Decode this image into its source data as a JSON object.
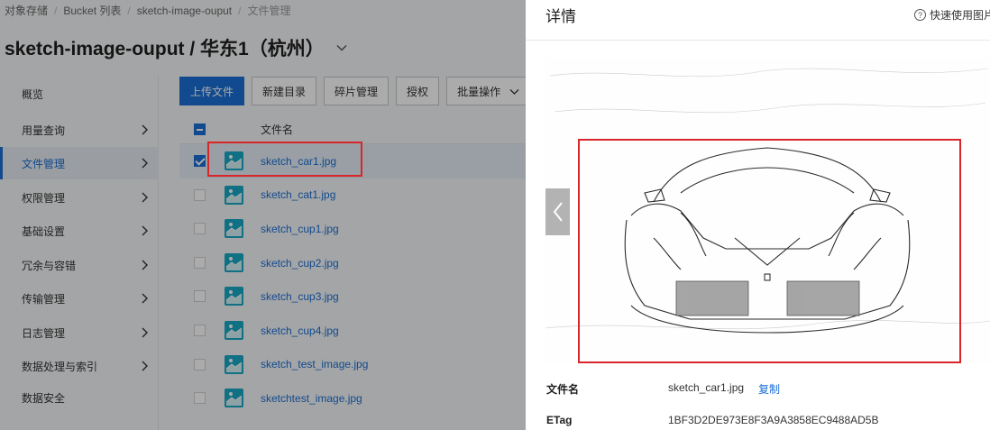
{
  "breadcrumb": {
    "items": [
      "对象存储",
      "Bucket 列表",
      "sketch-image-ouput"
    ],
    "current": "文件管理"
  },
  "page": {
    "title": "sketch-image-ouput / 华东1（杭州）"
  },
  "sidebar": {
    "items": [
      {
        "label": "概览"
      },
      {
        "label": "用量查询"
      },
      {
        "label": "文件管理"
      },
      {
        "label": "权限管理"
      },
      {
        "label": "基础设置"
      },
      {
        "label": "冗余与容错"
      },
      {
        "label": "传输管理"
      },
      {
        "label": "日志管理"
      },
      {
        "label": "数据处理与索引"
      },
      {
        "label": "数据安全"
      }
    ]
  },
  "toolbar": {
    "upload": "上传文件",
    "new_dir": "新建目录",
    "fragments": "碎片管理",
    "authorize": "授权",
    "batch": "批量操作"
  },
  "table": {
    "header": "文件名",
    "rows": [
      {
        "name": "sketch_car1.jpg",
        "checked": true
      },
      {
        "name": "sketch_cat1.jpg",
        "checked": false
      },
      {
        "name": "sketch_cup1.jpg",
        "checked": false
      },
      {
        "name": "sketch_cup2.jpg",
        "checked": false
      },
      {
        "name": "sketch_cup3.jpg",
        "checked": false
      },
      {
        "name": "sketch_cup4.jpg",
        "checked": false
      },
      {
        "name": "sketch_test_image.jpg",
        "checked": false
      },
      {
        "name": "sketchtest_image.jpg",
        "checked": false
      }
    ]
  },
  "drawer": {
    "title": "详情",
    "help": "快速使用图片",
    "fields": {
      "filename_label": "文件名",
      "filename_value": "sketch_car1.jpg",
      "copy": "复制",
      "etag_label": "ETag",
      "etag_value": "1BF3D2DE973E8F3A9A3858EC9488AD5B"
    }
  },
  "colors": {
    "accent": "#1a6fd4",
    "highlight": "#d9262a",
    "file_icon": "#19a8c5"
  }
}
